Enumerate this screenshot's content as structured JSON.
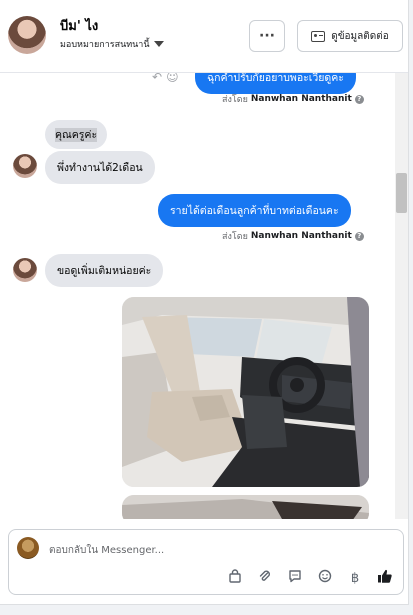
{
  "header": {
    "name": "บีม' ไง",
    "subtitle": "มอบหมายการสนทนานี้",
    "more_label": "···",
    "info_label": "ดูข้อมูลติดต่อ"
  },
  "messages": {
    "top_partial": "ฉุกคำปรับกัยอยาบพอะเวียดูคะ",
    "sent_by_prefix": "ส่งโดย",
    "sent_by_name": "Nanwhan Nanthanit",
    "in_1": "คุณครูค่ะ",
    "in_2": "พึ่งทำงานได้2เดือน",
    "out_1": "รายได้ต่อเดือนลูกค้าที่บาทต่อเดือนคะ",
    "in_3": "ขอดูเพิ่มเติมหน่อยค่ะ"
  },
  "composer": {
    "placeholder": "ตอบกลับใน Messenger..."
  },
  "icons": {
    "more": "more-icon",
    "info": "contact-card-icon",
    "help": "question-icon",
    "tools": [
      "bag-icon",
      "paperclip-icon",
      "chat-bubble-icon",
      "emoji-icon",
      "baht-icon",
      "like-icon"
    ]
  },
  "colors": {
    "accent": "#1877f2",
    "incoming_bubble": "#e4e6eb"
  }
}
